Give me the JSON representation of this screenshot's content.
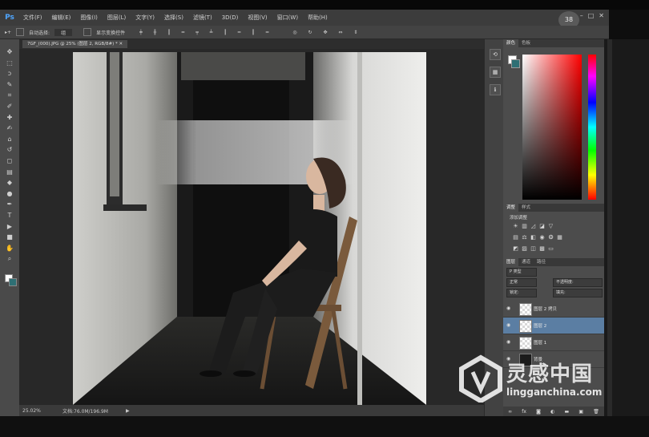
{
  "app": {
    "logo": "Ps",
    "clock_badge": "38",
    "window_controls": [
      "–",
      "□",
      "✕"
    ]
  },
  "menu": {
    "items": [
      "文件(F)",
      "编辑(E)",
      "图像(I)",
      "图层(L)",
      "文字(Y)",
      "选择(S)",
      "滤镜(T)",
      "3D(D)",
      "视图(V)",
      "窗口(W)",
      "帮助(H)"
    ]
  },
  "options_bar": {
    "auto_select_label": "自动选择:",
    "auto_select_value": "组",
    "show_transform_label": "显示变换控件"
  },
  "document": {
    "tab_title": "7GF_(000).JPG @ 25% (图层 2, RGB/8#) *  ✕"
  },
  "status": {
    "zoom": "25.02%",
    "doc_size": "文档:76.0M/196.9M"
  },
  "panels": {
    "color_tabs": [
      "颜色",
      "色板"
    ],
    "adjust_tabs": [
      "调整",
      "样式"
    ],
    "adjust_title": "添加调整",
    "layers_tabs": [
      "图层",
      "通道",
      "路径"
    ],
    "kind_filter": "P 类型",
    "blend_mode": "正常",
    "opacity_label": "不透明度:",
    "lock_label": "锁定:",
    "fill_label": "填充:",
    "layers": [
      {
        "name": "图层 2 拷贝",
        "selected": false
      },
      {
        "name": "图层 2",
        "selected": true
      },
      {
        "name": "图层 1",
        "selected": false
      },
      {
        "name": "背景",
        "selected": false
      }
    ]
  },
  "colors": {
    "foreground": "#ffffff",
    "background": "#2e6f74",
    "accent_selected_layer": "#5b7ea3",
    "ps_blue": "#4fa6ff"
  },
  "watermark": {
    "cn": "灵感中国",
    "url": "lingganchina.com"
  },
  "icons": {
    "tools": [
      "move-icon",
      "marquee-icon",
      "lasso-icon",
      "quick-select-icon",
      "crop-icon",
      "eyedropper-icon",
      "healing-icon",
      "brush-icon",
      "stamp-icon",
      "history-brush-icon",
      "eraser-icon",
      "gradient-icon",
      "blur-icon",
      "dodge-icon",
      "pen-icon",
      "type-icon",
      "path-select-icon",
      "shape-icon",
      "hand-icon",
      "zoom-icon"
    ]
  }
}
